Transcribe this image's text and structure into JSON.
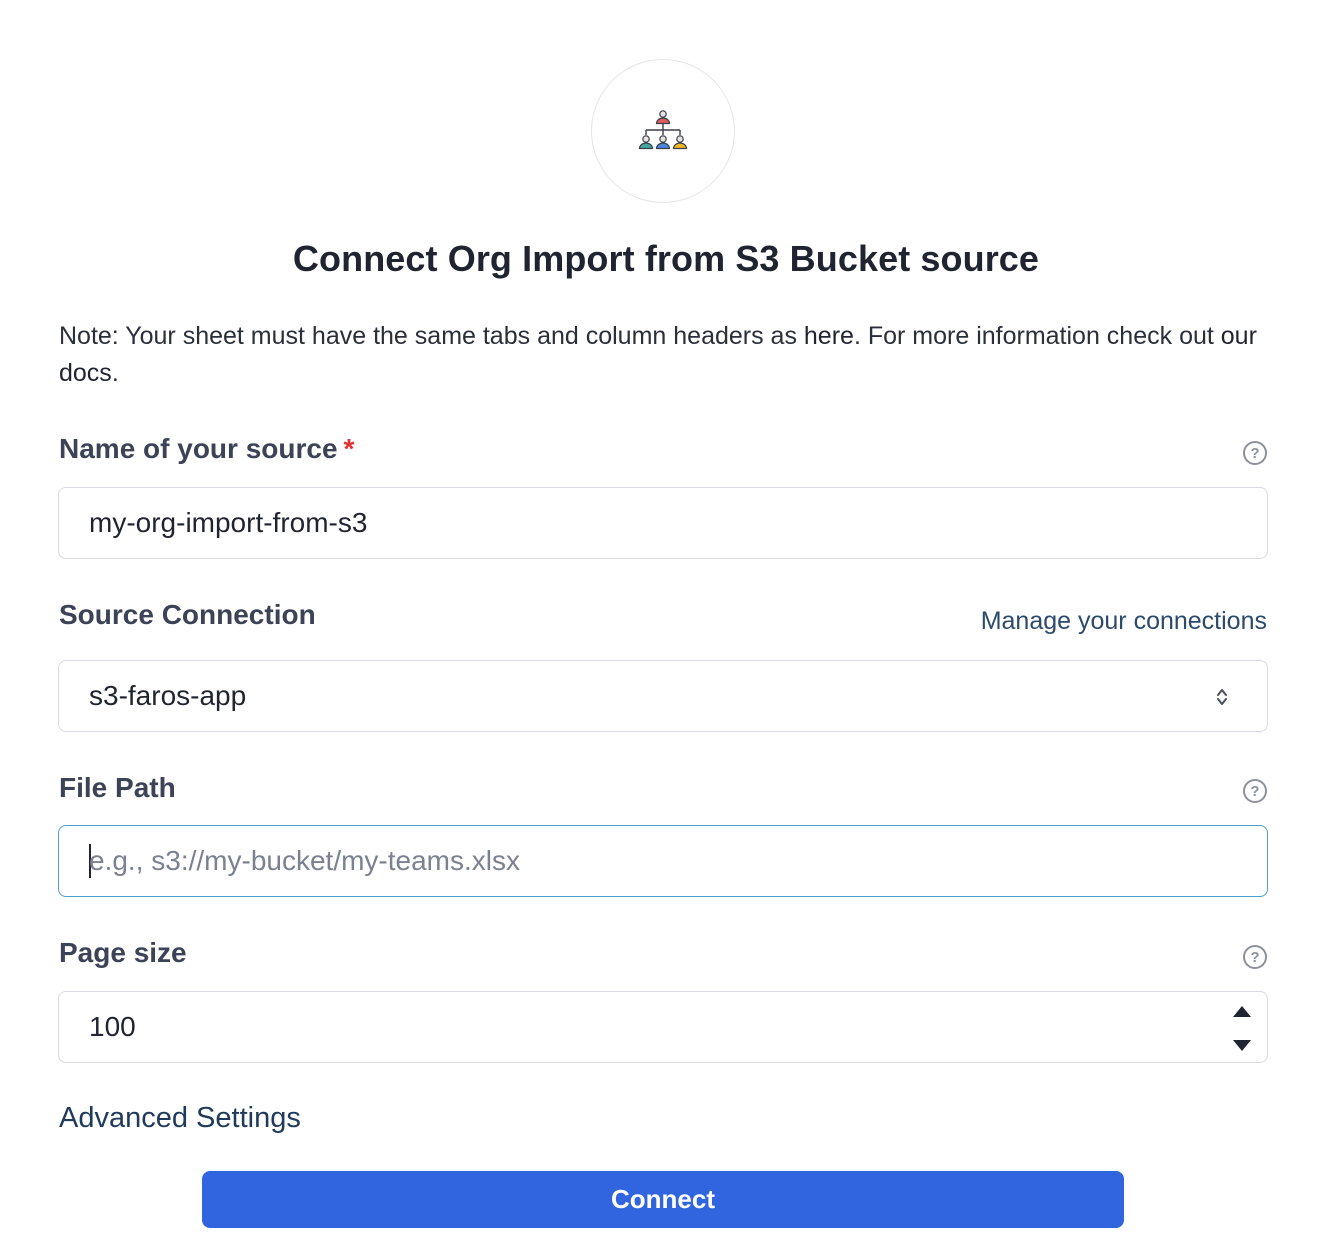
{
  "header": {
    "logo_icon": "org-chart-icon",
    "title": "Connect Org Import from S3 Bucket source"
  },
  "note": {
    "prefix": "Note: Your sheet must have the same tabs and column headers as ",
    "here_link": "here",
    "middle": ". For more information check out ",
    "docs_link": "our docs",
    "suffix": "."
  },
  "form": {
    "source_name": {
      "label": "Name of your source",
      "required_mark": "*",
      "value": "my-org-import-from-s3"
    },
    "source_connection": {
      "label": "Source Connection",
      "manage_link": "Manage your connections",
      "selected": "s3-faros-app"
    },
    "file_path": {
      "label": "File Path",
      "value": "",
      "placeholder": "e.g., s3://my-bucket/my-teams.xlsx"
    },
    "page_size": {
      "label": "Page size",
      "value": "100"
    },
    "help_glyph": "?",
    "advanced_label": "Advanced Settings",
    "connect_label": "Connect"
  },
  "colors": {
    "primary": "#3165e0",
    "required": "#e03131",
    "focus_border": "#4da0c9"
  }
}
